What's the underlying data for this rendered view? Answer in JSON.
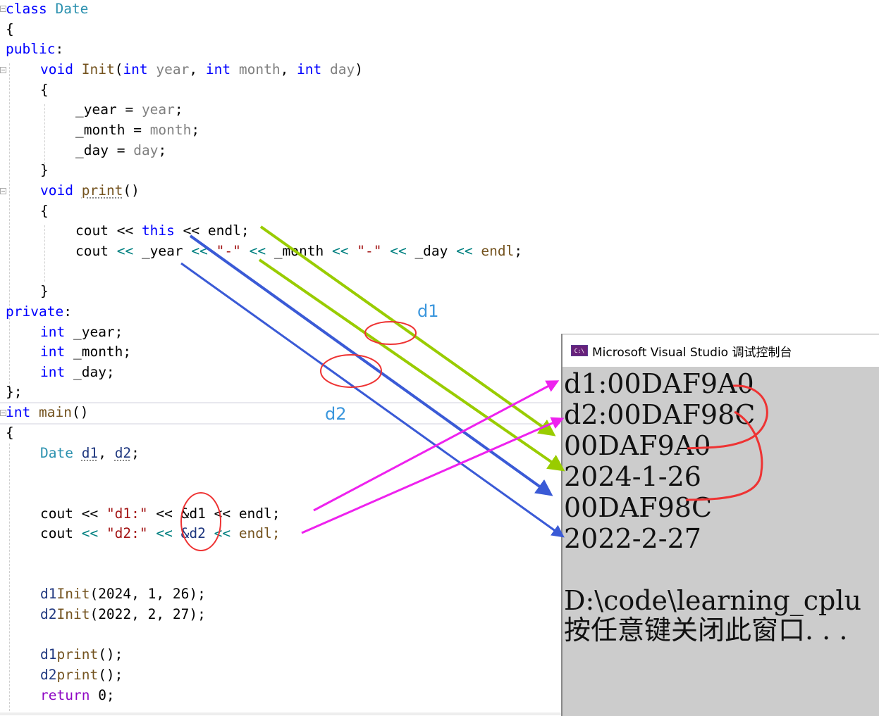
{
  "editor": {
    "lines": {
      "l1": {
        "k": "class",
        "t": "Date"
      },
      "l2": "{",
      "l3": {
        "k": "public",
        "p": ":"
      },
      "l4": {
        "k1": "void",
        "f": "Init",
        "a": "(",
        "k2": "int",
        "p1": "year",
        ",1": ", ",
        "k3": "int",
        "p2": "month",
        ",2": ", ",
        "k4": "int",
        "p3": "day",
        "c": ")"
      },
      "l5": "{",
      "l6": {
        "m": "_year",
        " eq": " = ",
        "p": "year",
        "s": ";"
      },
      "l7": {
        "m": "_month",
        " eq": " = ",
        "p": "month",
        "s": ";"
      },
      "l8": {
        "m": "_day",
        " eq": " = ",
        "p": "day",
        "s": ";"
      },
      "l9": "}",
      "l10": {
        "k": "void",
        "f": "print",
        "a": "()"
      },
      "l11": "{",
      "l12": {
        "c": "cout",
        "o1": " << ",
        "k": "this",
        "o2": " << ",
        "e": "endl;"
      },
      "l13": {
        "c": "cout",
        "o1": " << ",
        "m1": "_year",
        "o2": " << ",
        "s1": "\"-\"",
        "o3": " << ",
        "m2": "_month",
        "o4": " << ",
        "s2": "\"-\"",
        "o5": " << ",
        "m3": "_day",
        "o6": " << ",
        "e": "endl",
        "sc": ";"
      },
      "l14": "}",
      "l15": {
        "k": "private",
        "p": ":"
      },
      "l16": {
        "k": "int",
        "m": " _year;"
      },
      "l17": {
        "k": "int",
        "m": " _month;"
      },
      "l18": {
        "k": "int",
        "m": " _day;"
      },
      "l19": "};",
      "l20": {
        "k": "int",
        "f": "main",
        "a": "()"
      },
      "l21": "{",
      "l22": {
        "t": "Date",
        "v1": "d1",
        "c": ", ",
        "v2": "d2",
        "s": ";"
      },
      "l23": {
        "c": "cout",
        "o1": " << ",
        "s": "\"d1:\"",
        "o2": " << ",
        "a": "&d1",
        "o3": " << ",
        "e": "endl;"
      },
      "l24": {
        "c": "cout",
        "o1": " << ",
        "s": "\"d2:\"",
        "o2": " << ",
        "a": "&d2",
        "o3": " << ",
        "e": "endl;"
      },
      "l25": {
        "v": "d1",
        ".": ".",
        "f": "Init",
        "args": "(2024, 1, 26);"
      },
      "l26": {
        "v": "d2",
        ".": ".",
        "f": "Init",
        "args": "(2022, 2, 27);"
      },
      "l27": {
        "v": "d1",
        ".": ".",
        "f": "print",
        "args": "();"
      },
      "l28": {
        "v": "d2",
        ".": ".",
        "f": "print",
        "args": "();"
      },
      "l29": {
        "k": "return",
        "r": " 0;"
      }
    }
  },
  "annotations": {
    "label_d1": "d1",
    "label_d2": "d2",
    "colors": {
      "green": "#99cc00",
      "blue": "#3a5ad6",
      "magenta": "#ee22ee",
      "red": "#ee3333",
      "label": "#3a96dd"
    }
  },
  "console": {
    "title": "Microsoft Visual Studio 调试控制台",
    "icon_text": "C:\\",
    "output": [
      "d1:00DAF9A0",
      "d2:00DAF98C",
      "00DAF9A0",
      "2024-1-26",
      "00DAF98C",
      "2022-2-27",
      "",
      "D:\\code\\learning_cplu",
      "按任意键关闭此窗口. . ."
    ]
  }
}
